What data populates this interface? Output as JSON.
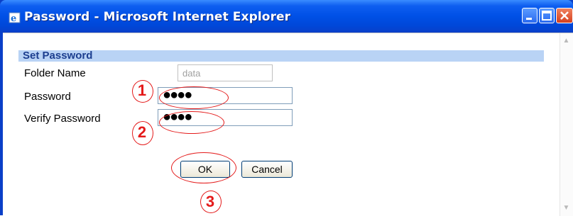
{
  "window": {
    "title": "Password - Microsoft Internet Explorer"
  },
  "form": {
    "section_title": "Set Password",
    "folder_name_label": "Folder Name",
    "folder_name_value": "data",
    "password_label": "Password",
    "password_mask": "●●●●",
    "verify_label": "Verify Password",
    "verify_mask": "●●●●",
    "ok_label": "OK",
    "cancel_label": "Cancel"
  },
  "annotations": {
    "step1": "1",
    "step2": "2",
    "step3": "3",
    "color": "#e41a1a"
  },
  "colors": {
    "titlebar": "#0050e6",
    "section_bg": "#b9d3f5",
    "section_text": "#1c3e8f"
  },
  "icons": {
    "window_icon": "ie-icon",
    "minimize": "minimize-icon",
    "maximize": "maximize-icon",
    "close": "close-icon"
  }
}
